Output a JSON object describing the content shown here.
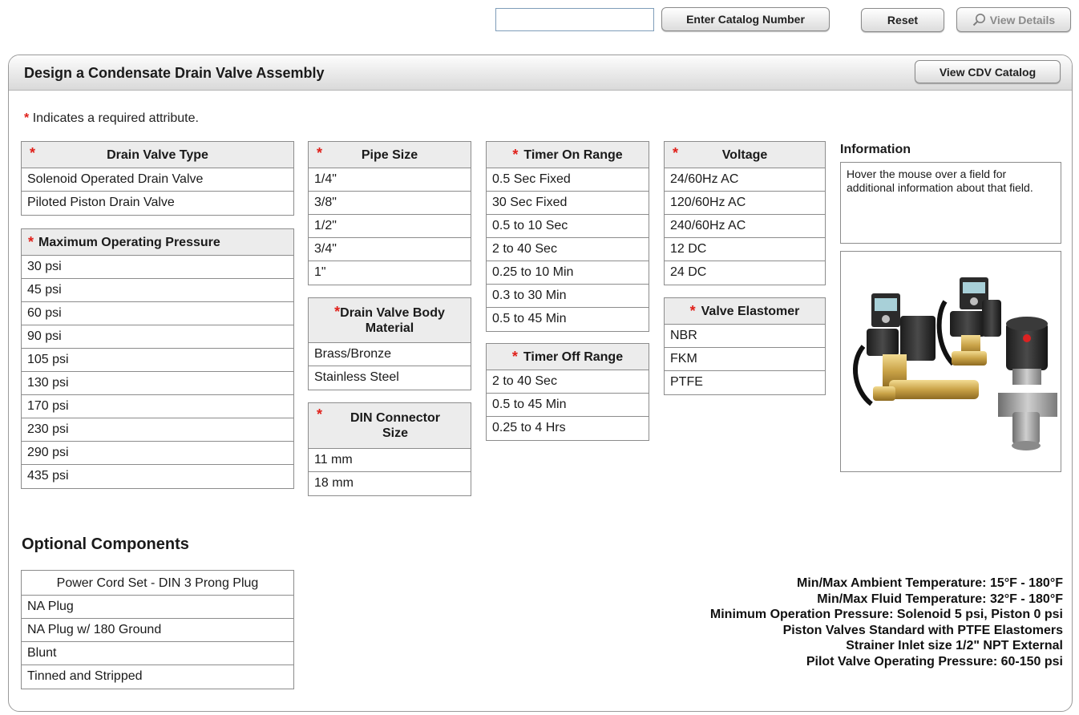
{
  "toolbar": {
    "catalog_input_value": "",
    "enter_catalog_label": "Enter Catalog Number",
    "reset_label": "Reset",
    "view_details_label": "View Details"
  },
  "panel": {
    "title": "Design a Condensate Drain Valve Assembly",
    "view_catalog_label": "View CDV Catalog",
    "required_note": "Indicates a required attribute.",
    "required_marker": "*"
  },
  "attributes": {
    "drain_valve_type": {
      "header": "Drain Valve Type",
      "options": [
        "Solenoid Operated Drain Valve",
        "Piloted Piston Drain Valve"
      ]
    },
    "max_pressure": {
      "header": "Maximum Operating Pressure",
      "options": [
        "30 psi",
        "45 psi",
        "60 psi",
        "90 psi",
        "105 psi",
        "130 psi",
        "170 psi",
        "230 psi",
        "290 psi",
        "435 psi"
      ]
    },
    "pipe_size": {
      "header": "Pipe Size",
      "options": [
        "1/4\"",
        "3/8\"",
        "1/2\"",
        "3/4\"",
        "1\""
      ]
    },
    "body_material": {
      "header_line1": "Drain Valve Body",
      "header_line2": "Material",
      "options": [
        "Brass/Bronze",
        "Stainless Steel"
      ]
    },
    "din_connector": {
      "header_line1": "DIN Connector",
      "header_line2": "Size",
      "options": [
        "11 mm",
        "18 mm"
      ]
    },
    "timer_on": {
      "header": "Timer On Range",
      "options": [
        "0.5 Sec Fixed",
        "30 Sec Fixed",
        "0.5 to 10 Sec",
        "2 to 40 Sec",
        "0.25 to 10 Min",
        "0.3 to 30 Min",
        "0.5 to 45 Min"
      ]
    },
    "timer_off": {
      "header": "Timer Off Range",
      "options": [
        "2 to 40 Sec",
        "0.5 to 45 Min",
        "0.25 to 4 Hrs"
      ]
    },
    "voltage": {
      "header": "Voltage",
      "options": [
        "24/60Hz AC",
        "120/60Hz AC",
        "240/60Hz AC",
        "12 DC",
        "24 DC"
      ]
    },
    "elastomer": {
      "header": "Valve Elastomer",
      "options": [
        "NBR",
        "FKM",
        "PTFE"
      ]
    }
  },
  "information": {
    "title": "Information",
    "text": "Hover the mouse over a field for additional information about that field."
  },
  "optional_components": {
    "title": "Optional Components",
    "header": "Power Cord Set - DIN 3 Prong Plug",
    "options": [
      "NA Plug",
      "NA Plug w/ 180 Ground",
      "Blunt",
      "Tinned and Stripped"
    ]
  },
  "specs": [
    "Min/Max Ambient Temperature: 15°F - 180°F",
    "Min/Max Fluid Temperature: 32°F - 180°F",
    "Minimum Operation Pressure: Solenoid 5 psi, Piston 0 psi",
    "Piston Valves Standard with PTFE Elastomers",
    "Strainer Inlet size 1/2\" NPT External",
    "Pilot Valve Operating Pressure: 60-150 psi"
  ],
  "colors": {
    "required_star": "#e0201a",
    "header_bg": "#ececec",
    "border": "#8c8c8c"
  }
}
